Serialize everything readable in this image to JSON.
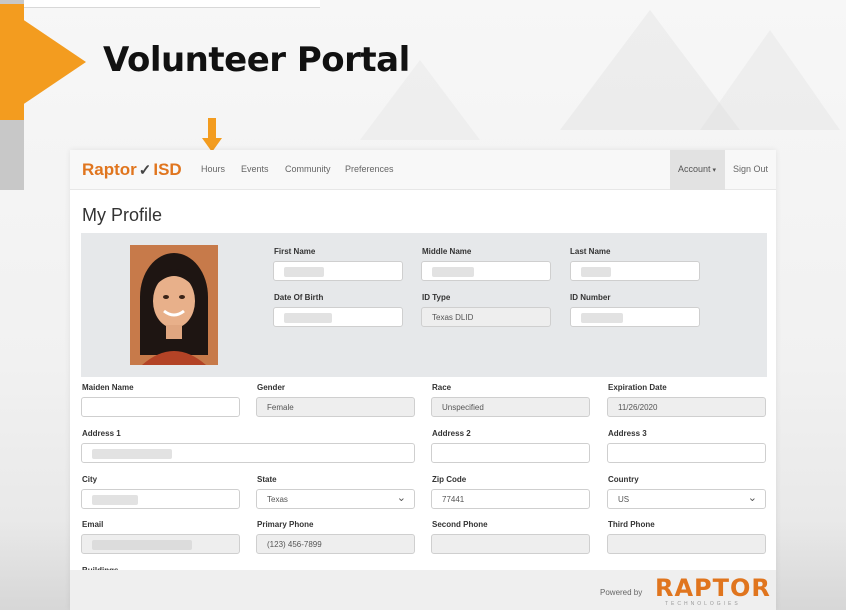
{
  "slide": {
    "title": "Volunteer Portal",
    "accent_color": "#f39c1f"
  },
  "app": {
    "brand": {
      "text": "Raptor",
      "suffix": "ISD",
      "icon": "raptor-bird-icon"
    },
    "nav": {
      "items": [
        "Hours",
        "Events",
        "Community",
        "Preferences"
      ],
      "account": "Account",
      "account_icon": "caret-down-icon",
      "signout": "Sign Out"
    },
    "page_title": "My Profile",
    "profile": {
      "first_name_label": "First Name",
      "middle_name_label": "Middle Name",
      "last_name_label": "Last Name",
      "dob_label": "Date Of Birth",
      "id_type_label": "ID Type",
      "id_type_value": "Texas DLID",
      "id_number_label": "ID Number"
    },
    "form": {
      "maiden_name_label": "Maiden Name",
      "gender_label": "Gender",
      "gender_value": "Female",
      "race_label": "Race",
      "race_value": "Unspecified",
      "expiration_label": "Expiration Date",
      "expiration_value": "11/26/2020",
      "address1_label": "Address 1",
      "address2_label": "Address 2",
      "address3_label": "Address 3",
      "city_label": "City",
      "state_label": "State",
      "state_value": "Texas",
      "zip_label": "Zip Code",
      "zip_value": "77441",
      "country_label": "Country",
      "country_value": "US",
      "email_label": "Email",
      "primary_phone_label": "Primary Phone",
      "primary_phone_value": "(123) 456-7899",
      "second_phone_label": "Second Phone",
      "third_phone_label": "Third Phone",
      "buildings_label": "Buildings"
    },
    "footer": {
      "powered_by": "Powered by",
      "logo": "RAPTOR",
      "logo_sub": "TECHNOLOGIES",
      "logo_color": "#e0751e"
    }
  }
}
